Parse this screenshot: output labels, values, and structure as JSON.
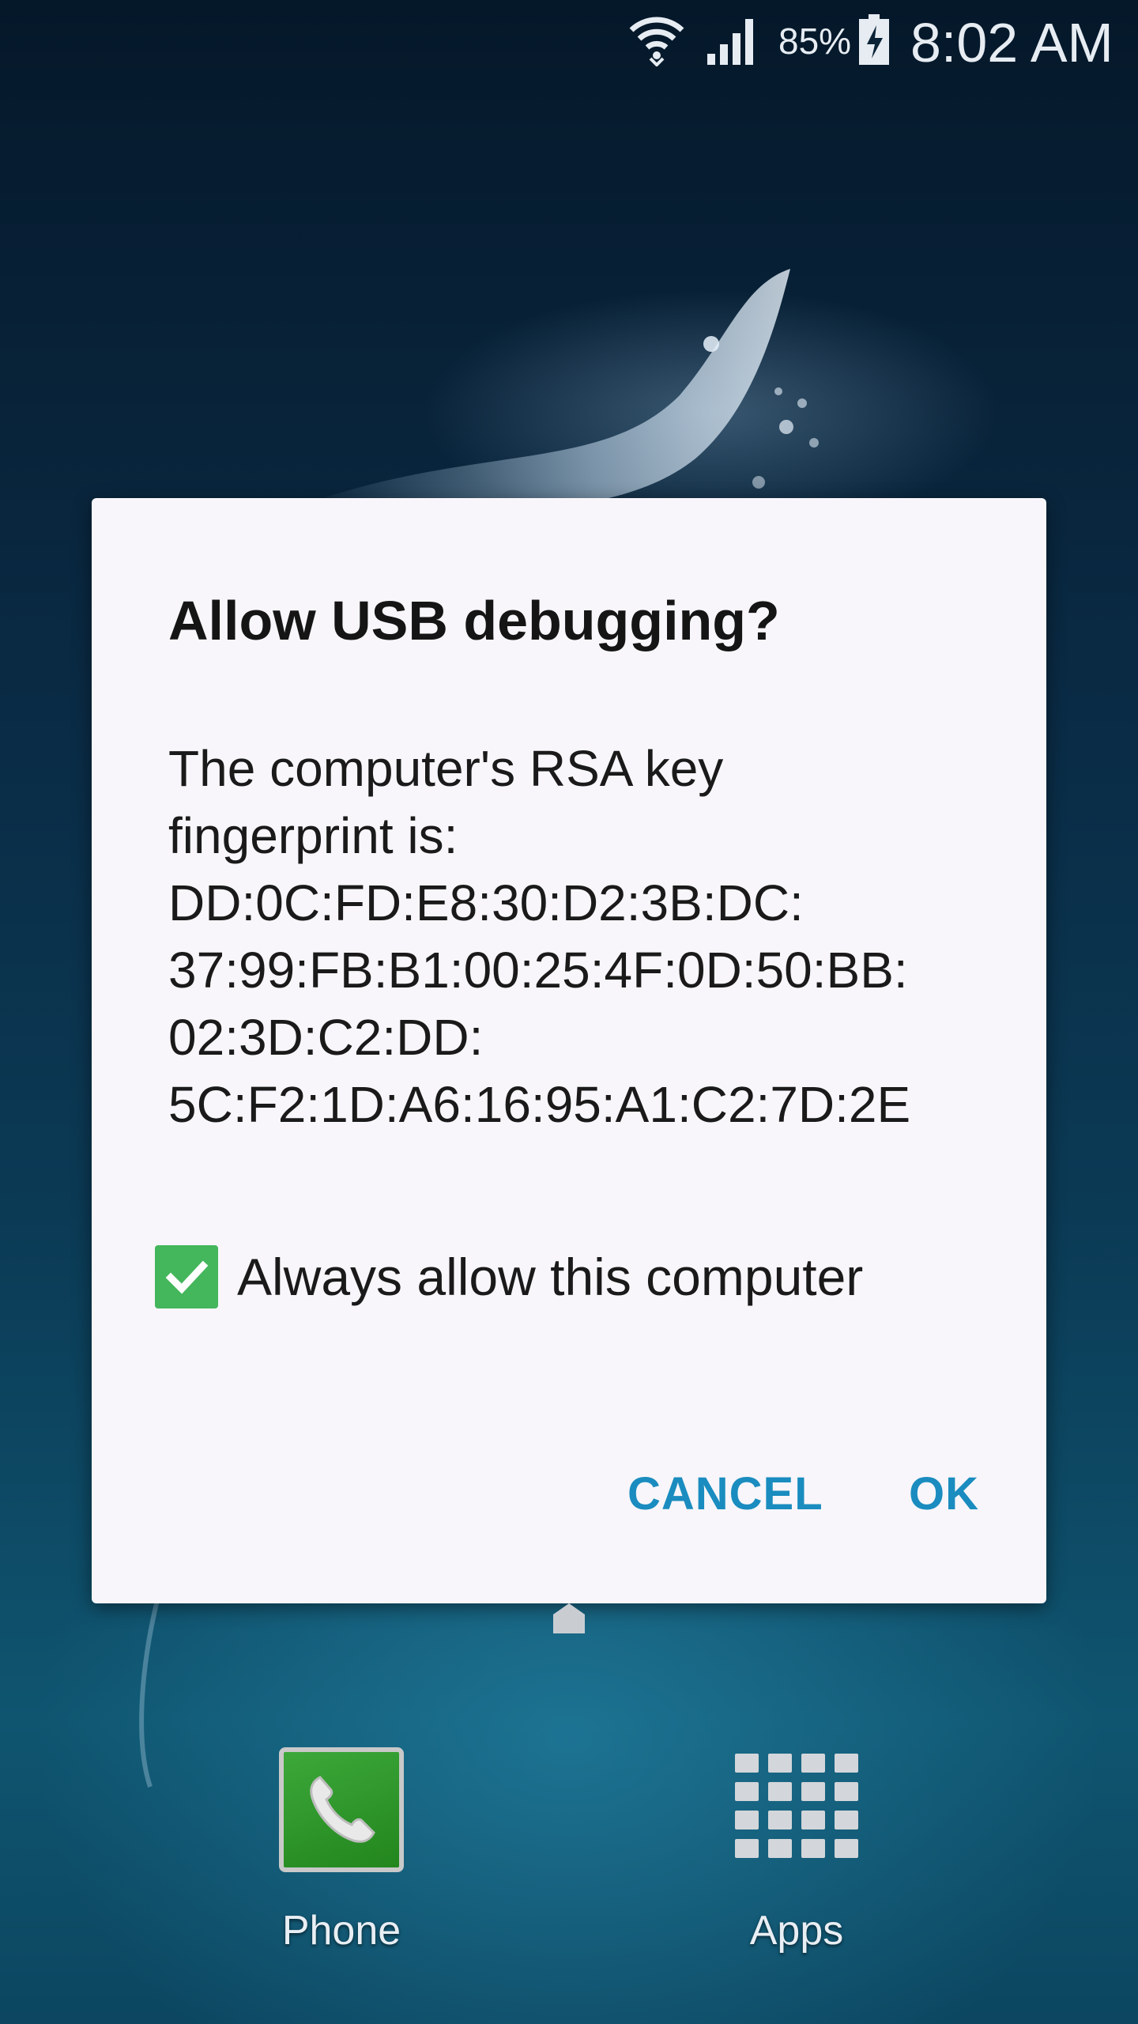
{
  "status_bar": {
    "battery_percent": "85%",
    "time": "8:02 AM",
    "icons": [
      "wifi-icon",
      "signal-icon",
      "battery-charging-icon"
    ]
  },
  "dialog": {
    "title": "Allow USB debugging?",
    "message_lines": [
      "The computer's RSA key",
      "fingerprint is:",
      "DD:0C:FD:E8:30:D2:3B:DC:",
      "37:99:FB:B1:00:25:4F:0D:50:BB:",
      "02:3D:C2:DD:",
      "5C:F2:1D:A6:16:95:A1:C2:7D:2E"
    ],
    "checkbox": {
      "label": "Always allow this computer",
      "checked": true
    },
    "buttons": {
      "cancel": "CANCEL",
      "ok": "OK"
    }
  },
  "dock": {
    "items": [
      {
        "label": "Phone",
        "icon": "phone-icon"
      },
      {
        "label": "Apps",
        "icon": "apps-grid-icon"
      }
    ]
  },
  "colors": {
    "accent": "#1a8cbf",
    "checkbox": "#44b65c",
    "dialog_bg": "#f8f6fa"
  }
}
